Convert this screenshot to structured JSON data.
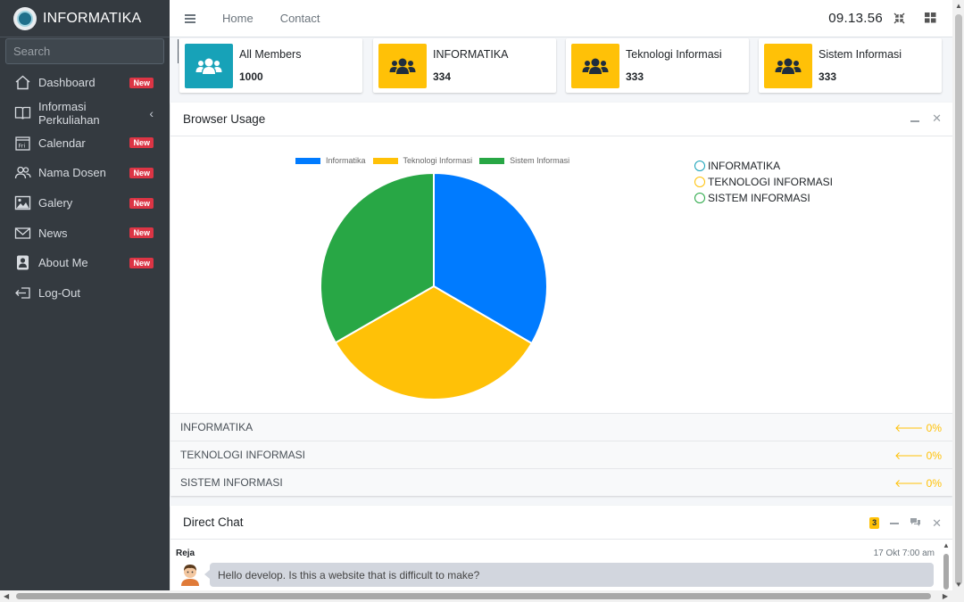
{
  "brand": {
    "name": "INFORMATIKA"
  },
  "search": {
    "placeholder": "Search"
  },
  "sidebar": {
    "items": [
      {
        "label": "Dashboard",
        "badge": "New",
        "icon": "home-icon"
      },
      {
        "label": "Informasi Perkuliahan",
        "icon": "book-icon"
      },
      {
        "label": "Calendar",
        "badge": "New",
        "icon": "calendar-icon"
      },
      {
        "label": "Nama Dosen",
        "badge": "New",
        "icon": "users-icon"
      },
      {
        "label": "Galery",
        "badge": "New",
        "icon": "image-icon"
      },
      {
        "label": "News",
        "badge": "New",
        "icon": "envelope-icon"
      },
      {
        "label": "About Me",
        "badge": "New",
        "icon": "person-icon"
      },
      {
        "label": "Log-Out",
        "icon": "logout-icon"
      }
    ],
    "calendar_icon_text": "Fri"
  },
  "topbar": {
    "home": "Home",
    "contact": "Contact",
    "clock": "09.13.56"
  },
  "info_boxes": [
    {
      "label": "All Members",
      "value": "1000",
      "color": "#17a2b8"
    },
    {
      "label": "INFORMATIKA",
      "value": "334",
      "color": "#ffc107"
    },
    {
      "label": "Teknologi Informasi",
      "value": "333",
      "color": "#ffc107"
    },
    {
      "label": "Sistem Informasi",
      "value": "333",
      "color": "#ffc107"
    }
  ],
  "browser_card": {
    "title": "Browser Usage",
    "legend_top": [
      "Informatika",
      "Teknologi Informasi",
      "Sistem Informasi"
    ],
    "legend_right": [
      "INFORMATIKA",
      "TEKNOLOGI INFORMASI",
      "SISTEM INFORMASI"
    ],
    "rows": [
      {
        "label": "INFORMATIKA",
        "value": "0%"
      },
      {
        "label": "TEKNOLOGI INFORMASI",
        "value": "0%"
      },
      {
        "label": "SISTEM INFORMASI",
        "value": "0%"
      }
    ]
  },
  "chart_data": {
    "type": "pie",
    "categories": [
      "Informatika",
      "Teknologi Informasi",
      "Sistem Informasi"
    ],
    "values": [
      334,
      333,
      333
    ],
    "colors": [
      "#007bff",
      "#ffc107",
      "#28a745"
    ]
  },
  "chat": {
    "title": "Direct Chat",
    "badge": "3",
    "message": {
      "name": "Reja",
      "time": "17 Okt 7:00 am",
      "text": "Hello develop. Is this a website that is difficult to make?"
    }
  }
}
